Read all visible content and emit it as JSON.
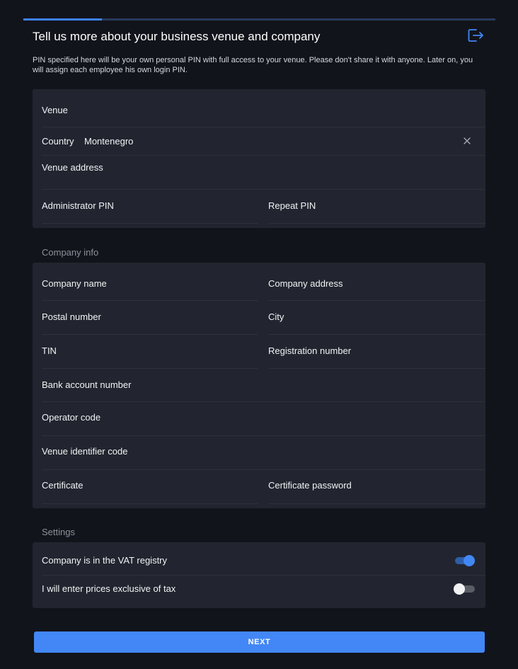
{
  "header": {
    "title": "Tell us more about your business venue and company",
    "description": "PIN specified here will be your own personal PIN with full access to your venue. Please don't share it with anyone. Later on, you will assign each employee his own login PIN.",
    "exit_icon": "logout-icon",
    "progress_fraction": 0.166
  },
  "venue_section": {
    "venue_label": "Venue",
    "country_label": "Country",
    "country_value": "Montenegro",
    "clear_icon": "close-icon",
    "address_label": "Venue address",
    "admin_pin_label": "Administrator PIN",
    "repeat_pin_label": "Repeat PIN"
  },
  "company_section": {
    "title": "Company info",
    "company_name_label": "Company name",
    "company_address_label": "Company address",
    "postal_label": "Postal number",
    "city_label": "City",
    "tin_label": "TIN",
    "registration_label": "Registration number",
    "bank_label": "Bank account number",
    "operator_label": "Operator code",
    "venue_identifier_label": "Venue identifier code",
    "certificate_label": "Certificate",
    "certificate_password_label": "Certificate password"
  },
  "settings_section": {
    "title": "Settings",
    "vat_label": "Company is in the VAT registry",
    "vat_on": true,
    "tax_label": "I will enter prices exclusive of tax",
    "tax_on": false
  },
  "footer": {
    "next_label": "NEXT"
  },
  "colors": {
    "accent": "#4287f5",
    "background": "#12141b",
    "card": "#22252f"
  }
}
